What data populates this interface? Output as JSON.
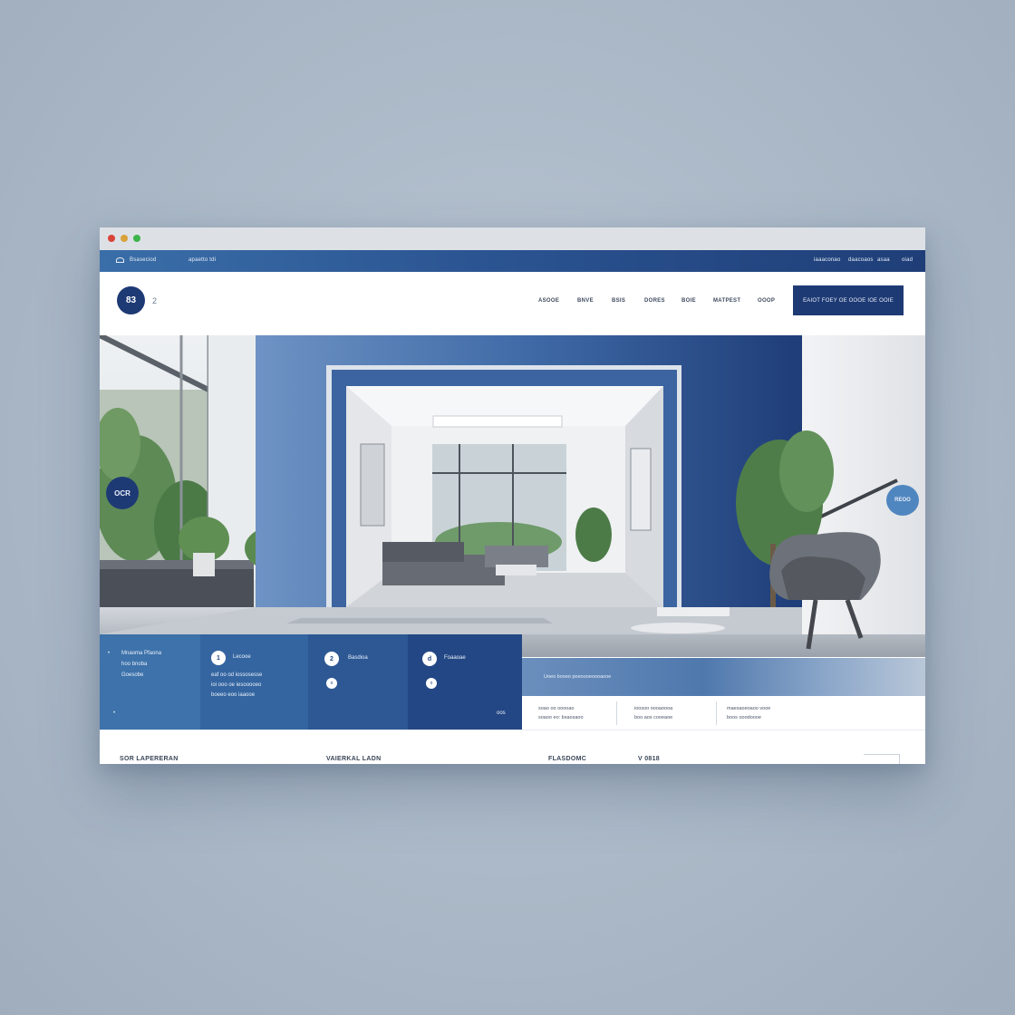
{
  "window": {
    "controls": [
      "close",
      "minimize",
      "maximize"
    ]
  },
  "topbar": {
    "brand": "Bsaseciod",
    "contact": "apaetto tdi",
    "links": [
      "iaaaconao",
      "daacoaos",
      "asaa",
      "oiad"
    ]
  },
  "navbar": {
    "logo_badge": "83",
    "logo_text": "2",
    "items": [
      "ASOOE",
      "BNVE",
      "BSIS",
      "DORES",
      "BOIE",
      "MATPEST",
      "OOOP"
    ],
    "cta_label": "EAIOT FOEY OE OOOE IOE OOIE"
  },
  "hero": {
    "left_badge": "OCR",
    "right_badge": "REOO"
  },
  "cards": [
    {
      "title": "Mnaoma Pfaona",
      "line2": "hoo bnoba",
      "line3": "Goesobe"
    },
    {
      "icon": "1",
      "title": "Lecooe",
      "line1": "eaf oo od iossosesse",
      "line2": "ioi ooo oe iesooooeo",
      "line3": "boeeo eoo iaaooe"
    },
    {
      "icon": "2",
      "title": "Basdioa",
      "sub_icon": "o"
    },
    {
      "icon": "d",
      "title": "Foaaoae",
      "sub_icon": "o",
      "corner": "oos"
    }
  ],
  "strip": {
    "text": "Uoeo booeo poeoooeoooaooe"
  },
  "info_columns": [
    {
      "line1": "soao oo ooooao",
      "line2": "soaoo eo: bsaosaoo"
    },
    {
      "line1": "ioosoo oooaoooa",
      "line2": "boo aos cooeaoe"
    },
    {
      "line1": "maesaoeoaoo vooe",
      "line2": "boos ooodoooe"
    }
  ],
  "footer": {
    "items": [
      "SOR LAPERERAN",
      "VAIERKAL LADN",
      "FLASDOMC",
      "V 0818"
    ]
  },
  "colors": {
    "primary": "#1e3a74",
    "accent": "#3d72aa",
    "background": "#a9b7c6"
  }
}
